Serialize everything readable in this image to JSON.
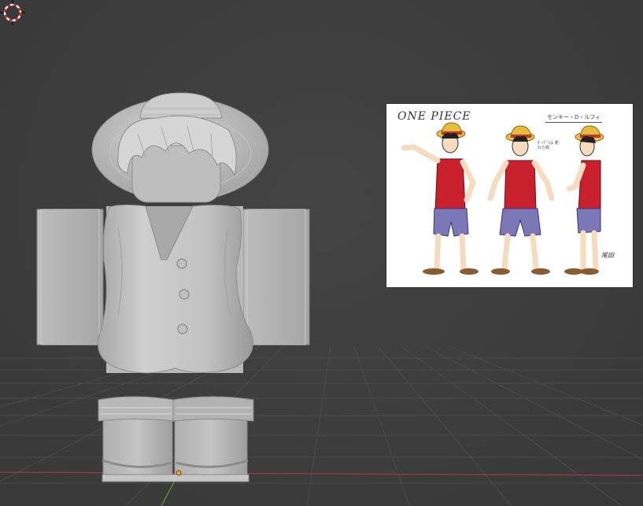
{
  "viewport": {
    "background": "#3d3d3d",
    "grid_color": "#4a4a4a",
    "x_axis_color": "#9b3a44",
    "y_axis_color": "#6a8f2e"
  },
  "reference_image": {
    "title": "ONE PIECE",
    "name_label": "モンキー・D・ルフィ",
    "note_text": "ﾀﾞｯｸﾞﾂは 麦わら帽",
    "signature": "尾田"
  },
  "model": {
    "material_color": "#c8c8c8",
    "origin_color": "#f0a030"
  },
  "icons": {
    "cursor": "3d-cursor-icon",
    "origin": "origin-point-icon"
  }
}
